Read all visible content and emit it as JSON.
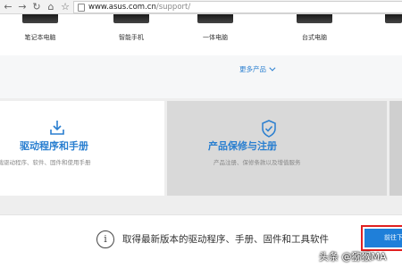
{
  "browser": {
    "url_domain": "www.asus.com.cn",
    "url_path": "/support/"
  },
  "products": {
    "items": [
      {
        "label": "笔记本电脑"
      },
      {
        "label": "智能手机"
      },
      {
        "label": "一体电脑"
      },
      {
        "label": "台式电脑"
      }
    ],
    "more_label": "更多产品"
  },
  "cards": {
    "drivers": {
      "title": "驱动程序和手册",
      "desc": "下载驱动程序、软件、固件和使用手册"
    },
    "warranty": {
      "title": "产品保修与注册",
      "desc": "产品注册、保修条款以及增值服务"
    }
  },
  "banner": {
    "text": "取得最新版本的驱动程序、手册、固件和工具软件",
    "button_label": "前往下载"
  },
  "watermark": "头条 @猕猴MA",
  "colors": {
    "accent": "#2a7fd0",
    "button": "#1f7fd9",
    "highlight_frame": "#e02020"
  }
}
